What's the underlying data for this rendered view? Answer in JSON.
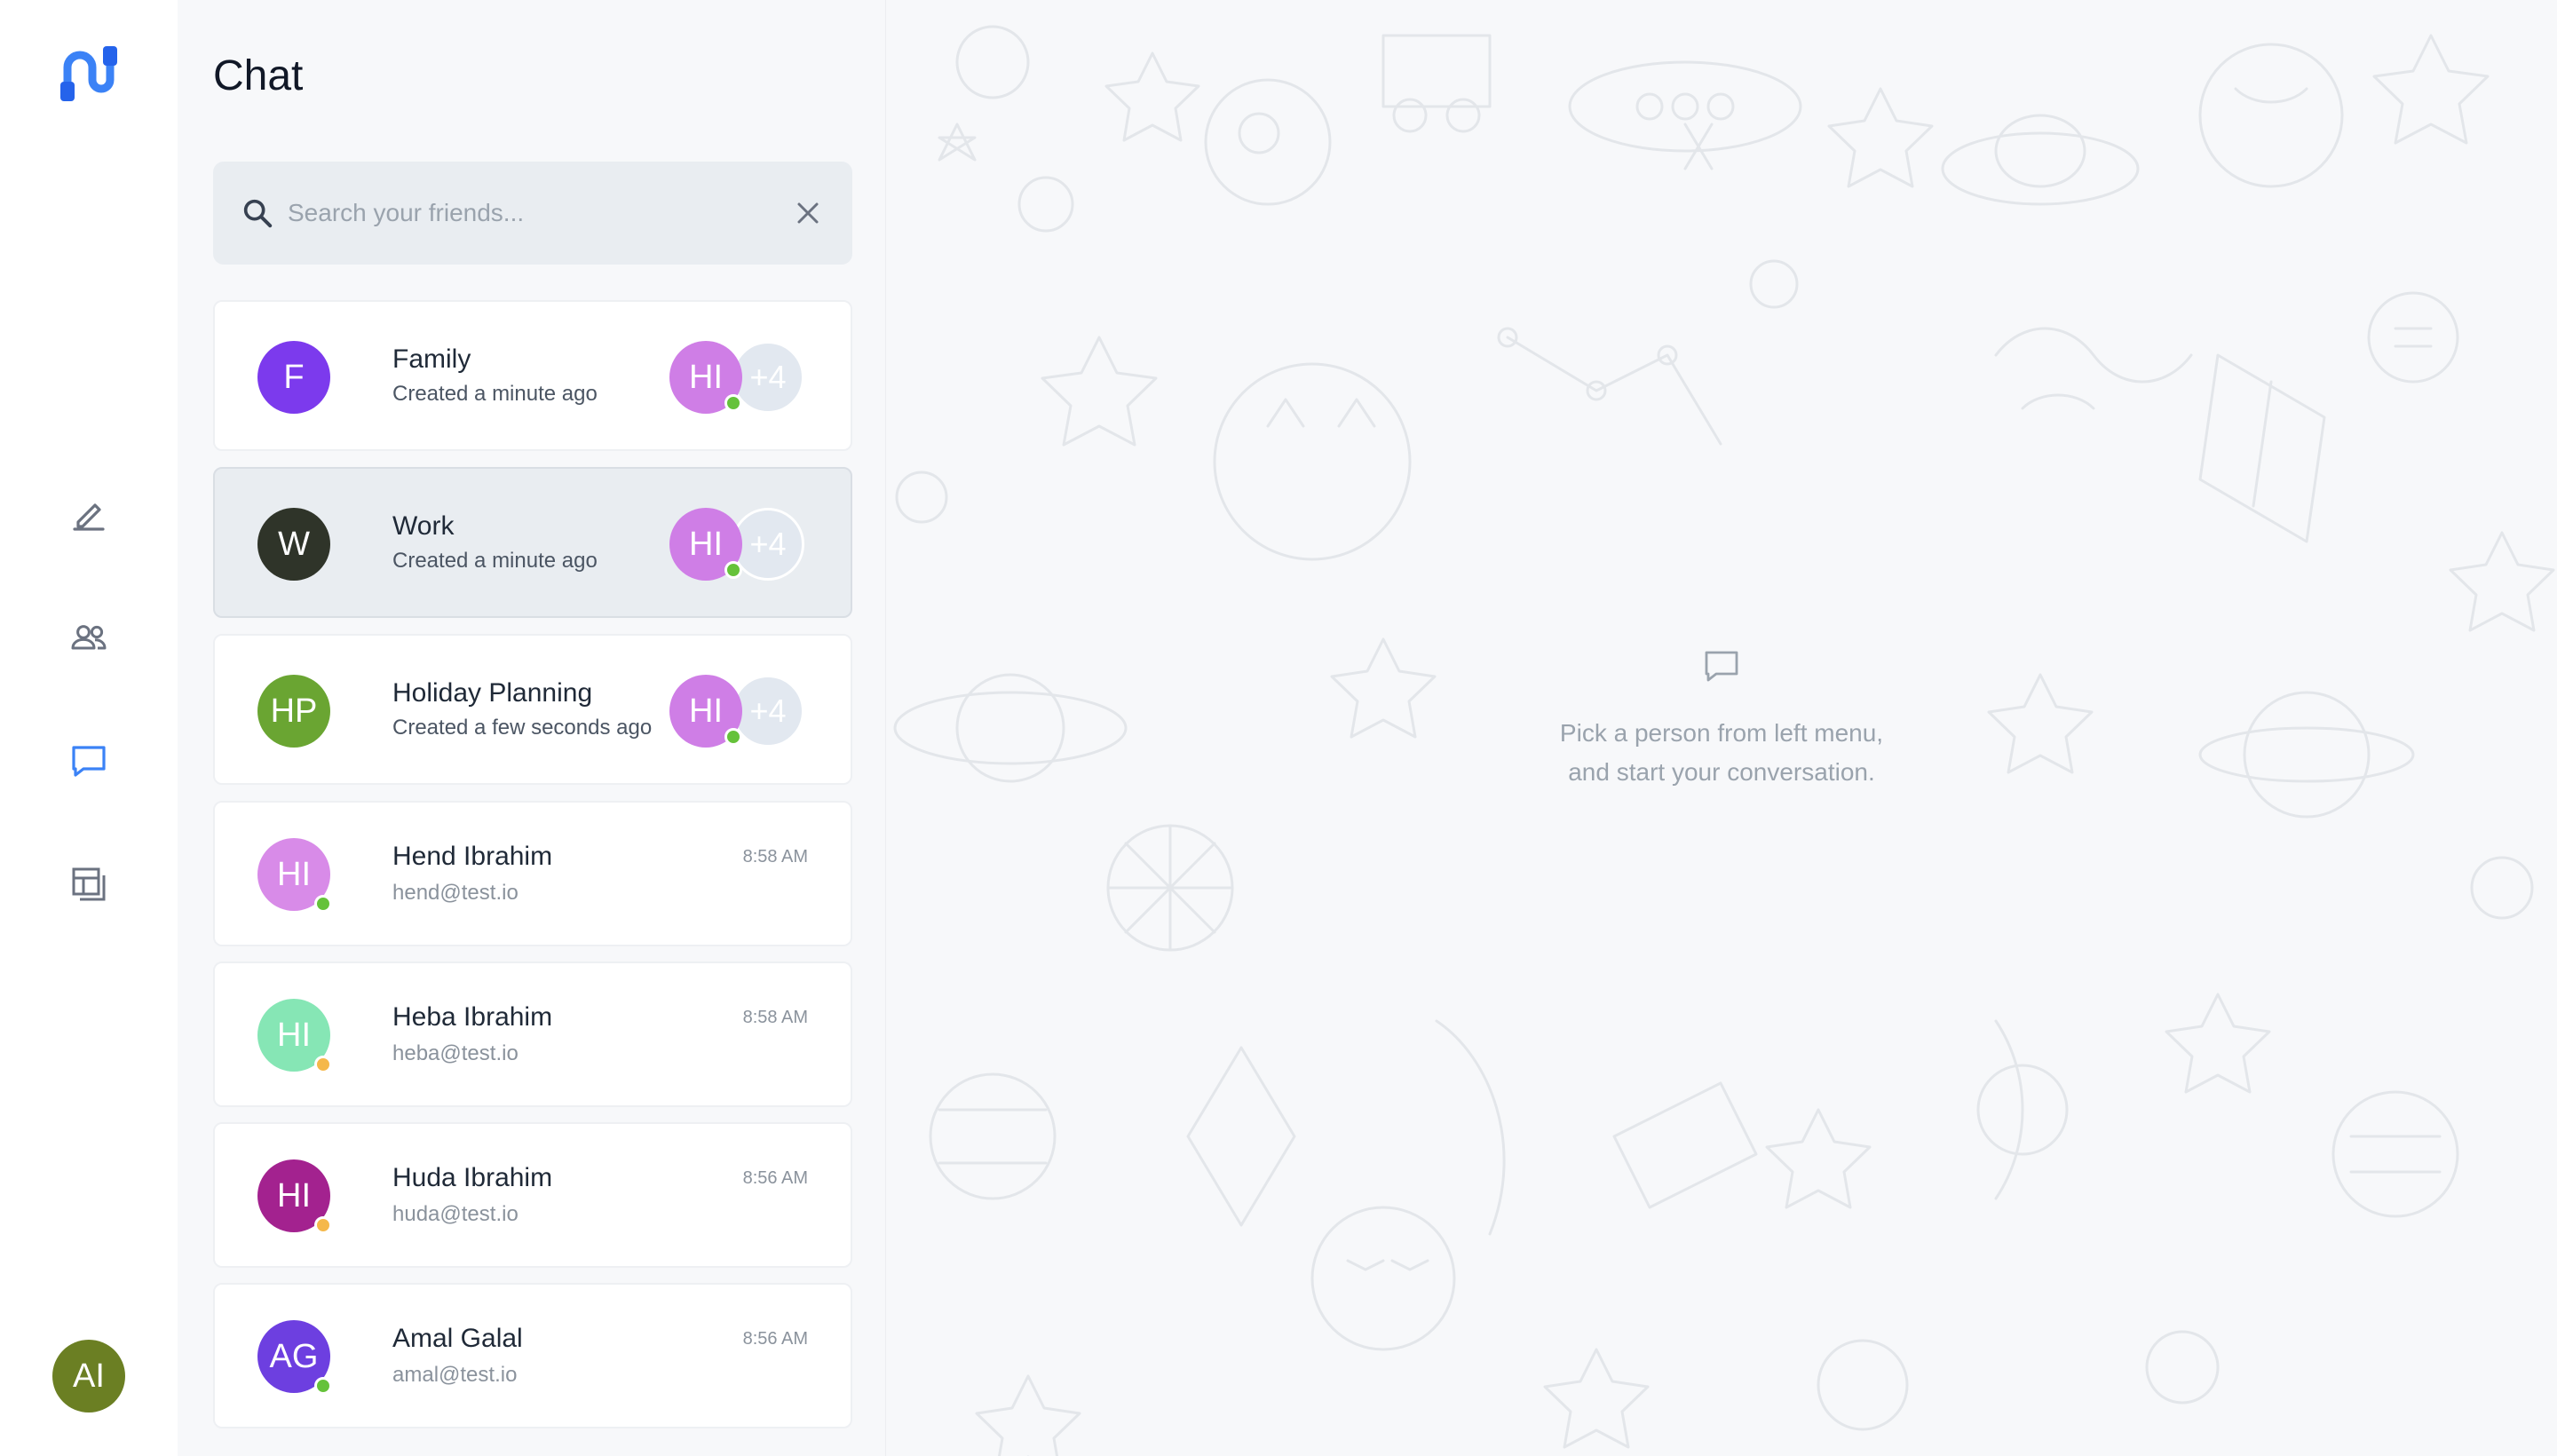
{
  "panel": {
    "title": "Chat",
    "search_placeholder": "Search your friends..."
  },
  "rail": {
    "icons": [
      "logo-icon",
      "edit-icon",
      "users-icon",
      "chat-icon",
      "layout-icon"
    ],
    "user_initials": "AI"
  },
  "groups": [
    {
      "initials": "F",
      "name": "Family",
      "subtitle": "Created a minute ago",
      "member_initials": "HI",
      "extra": "+4",
      "color": "#7c3aed"
    },
    {
      "initials": "W",
      "name": "Work",
      "subtitle": "Created a minute ago",
      "member_initials": "HI",
      "extra": "+4",
      "color": "#2f3429"
    },
    {
      "initials": "HP",
      "name": "Holiday Planning",
      "subtitle": "Created a few seconds ago",
      "member_initials": "HI",
      "extra": "+4",
      "color": "#6aa532"
    }
  ],
  "contacts": [
    {
      "initials": "HI",
      "name": "Hend Ibrahim",
      "email": "hend@test.io",
      "time": "8:58 AM",
      "color": "#d88be8",
      "status": "online"
    },
    {
      "initials": "HI",
      "name": "Heba Ibrahim",
      "email": "heba@test.io",
      "time": "8:58 AM",
      "color": "#86e6b5",
      "status": "away"
    },
    {
      "initials": "HI",
      "name": "Huda Ibrahim",
      "email": "huda@test.io",
      "time": "8:56 AM",
      "color": "#a3228f",
      "status": "away"
    },
    {
      "initials": "AG",
      "name": "Amal Galal",
      "email": "amal@test.io",
      "time": "8:56 AM",
      "color": "#6d3fe0",
      "status": "online"
    }
  ],
  "empty_state": {
    "line1": "Pick a person from left menu,",
    "line2": "and start your conversation."
  },
  "colors": {
    "accent": "#3b82f6",
    "online": "#65c23a",
    "away": "#f5b84a"
  }
}
